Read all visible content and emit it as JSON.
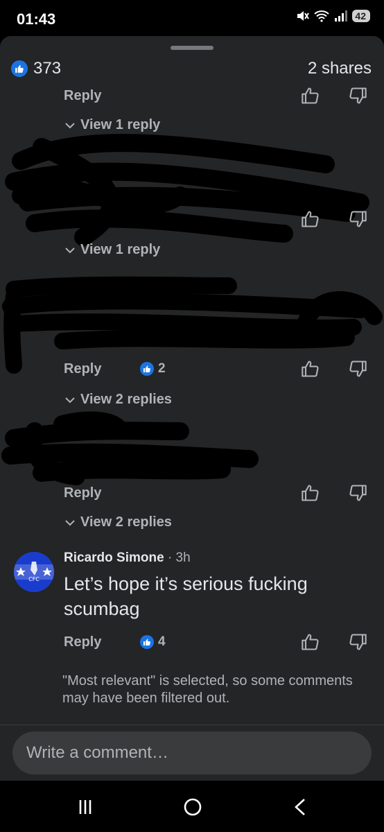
{
  "status": {
    "time": "01:43",
    "battery": "42"
  },
  "post_stats": {
    "likes": "373",
    "shares": "2 shares"
  },
  "actions": {
    "reply": "Reply"
  },
  "threads": [
    {
      "view_replies": "View 1 reply"
    },
    {
      "view_replies": "View 1 reply"
    },
    {
      "reaction_count": "2",
      "view_replies": "View 2 replies"
    },
    {
      "view_replies": "View 2 replies"
    }
  ],
  "comment": {
    "author": "Ricardo Simone",
    "time": "· 3h",
    "text": "Let’s hope it’s serious fucking scumbag",
    "reaction_count": "4",
    "avatar_label": "CFC"
  },
  "filter_note": "\"Most relevant\" is selected, so some comments may have been filtered out.",
  "composer": {
    "placeholder": "Write a comment…"
  },
  "icons": {
    "like": "thumbs-up-icon",
    "dislike": "thumbs-down-icon",
    "chevron": "chevron-down-icon",
    "accent": "#1b74e4"
  }
}
